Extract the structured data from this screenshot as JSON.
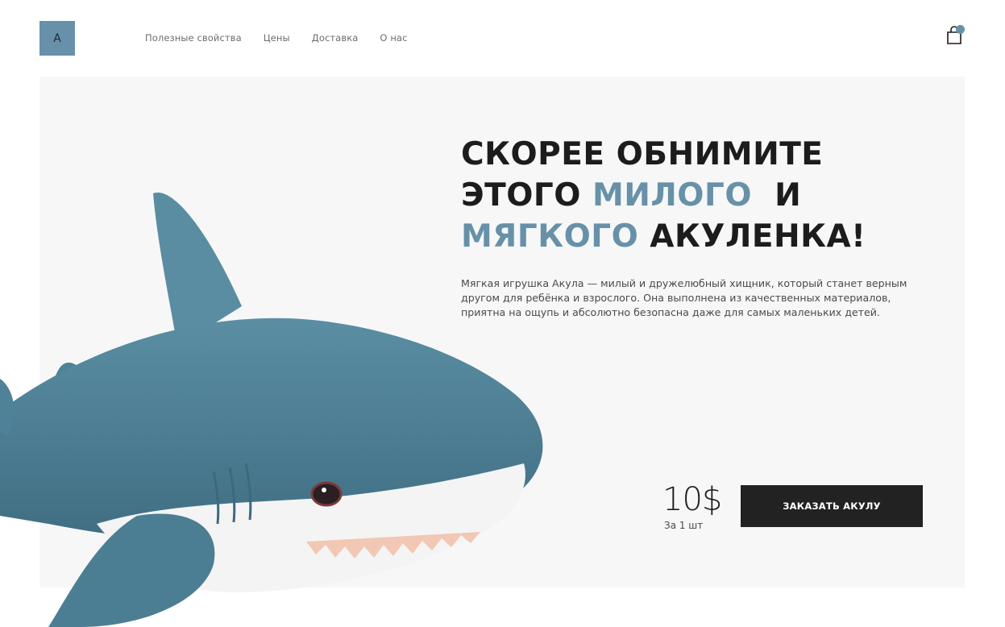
{
  "header": {
    "logo_letter": "A",
    "nav": [
      {
        "label": "Полезные свойства"
      },
      {
        "label": "Цены"
      },
      {
        "label": "Доставка"
      },
      {
        "label": "О нас"
      }
    ],
    "cart_icon": "shopping-bag-icon"
  },
  "hero": {
    "headline": {
      "line1": "СКОРЕЕ ОБНИМИТЕ",
      "line2_start": "ЭТОГО ",
      "line2_accent": "МИЛОГО",
      "line2_end": "И",
      "line3_accent": "МЯГКОГО",
      "line3_end": " АКУЛЕНКА!"
    },
    "description": "Мягкая игрушка Акула — милый и дружелюбный хищник, который станет верным другом для ребёнка и взрослого. Она выполнена из качественных материалов, приятна на ощупь и абсолютно безопасна даже для самых маленьких детей.",
    "price": "10$",
    "price_unit": "За 1 шт",
    "order_label": "ЗАКАЗАТЬ АКУЛУ",
    "image": "plush-shark-illustration"
  },
  "colors": {
    "accent": "#6791a8",
    "text": "#1c1c1c",
    "hero_bg": "#f7f7f7",
    "button_bg": "#222222",
    "shark_body": "#4f7f93",
    "shark_belly": "#f3f3f3"
  }
}
